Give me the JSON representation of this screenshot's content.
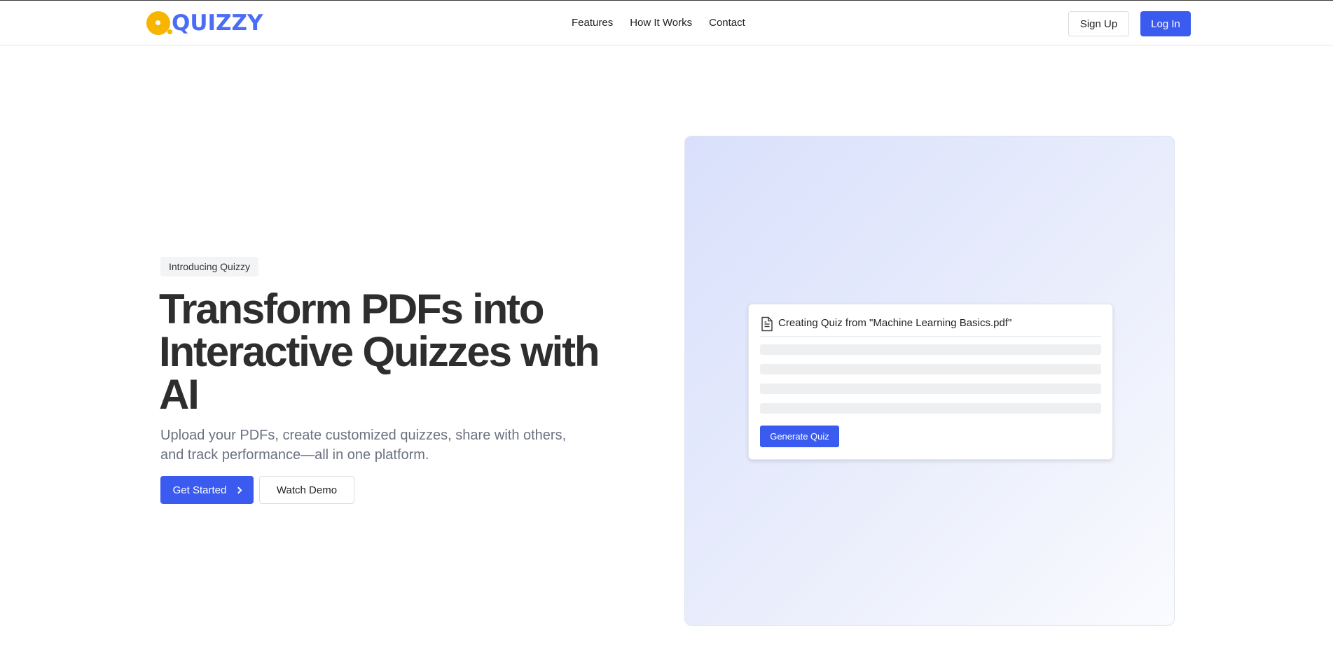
{
  "brand": {
    "logo_text": "QUIZZY",
    "colors": {
      "primary": "#3b5bf0",
      "logo_blue": "#4a6cf7",
      "logo_yellow": "#f7b500"
    }
  },
  "nav": {
    "links": [
      {
        "label": "Features"
      },
      {
        "label": "How It Works"
      },
      {
        "label": "Contact"
      }
    ],
    "signup_label": "Sign Up",
    "login_label": "Log In"
  },
  "hero": {
    "badge": "Introducing Quizzy",
    "title": "Transform PDFs into Interactive Quizzes with AI",
    "subtitle": "Upload your PDFs, create customized quizzes, share with others, and track performance—all in one platform.",
    "primary_cta": "Get Started",
    "primary_cta_icon": "chevron-right-icon",
    "secondary_cta": "Watch Demo"
  },
  "preview": {
    "card_icon": "document-icon",
    "card_title": "Creating Quiz from \"Machine Learning Basics.pdf\"",
    "skeleton_line_count": 4,
    "generate_label": "Generate Quiz"
  }
}
